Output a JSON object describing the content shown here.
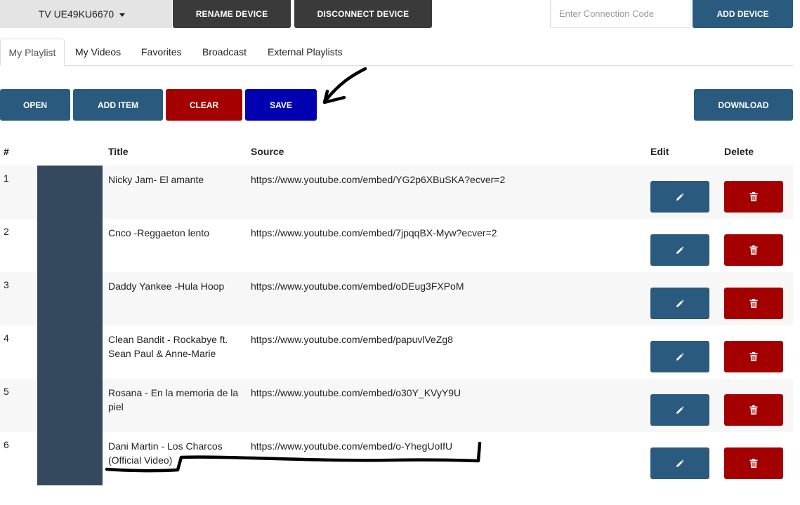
{
  "topbar": {
    "device_name": "TV UE49KU6670",
    "rename_label": "RENAME DEVICE",
    "disconnect_label": "DISCONNECT DEVICE",
    "connection_placeholder": "Enter Connection Code",
    "add_device_label": "ADD DEVICE"
  },
  "tabs": [
    "My Playlist",
    "My Videos",
    "Favorites",
    "Broadcast",
    "External Playlists"
  ],
  "toolbar": {
    "open": "OPEN",
    "add_item": "ADD ITEM",
    "clear": "CLEAR",
    "save": "SAVE",
    "download": "DOWNLOAD"
  },
  "table": {
    "headers": {
      "num": "#",
      "title": "Title",
      "source": "Source",
      "edit": "Edit",
      "delete": "Delete"
    },
    "rows": [
      {
        "num": "1",
        "title": "Nicky Jam- El amante",
        "source": "https://www.youtube.com/embed/YG2p6XBuSKA?ecver=2"
      },
      {
        "num": "2",
        "title": "Cnco -Reggaeton lento",
        "source": "https://www.youtube.com/embed/7jpqqBX-Myw?ecver=2"
      },
      {
        "num": "3",
        "title": "Daddy Yankee -Hula Hoop",
        "source": "https://www.youtube.com/embed/oDEug3FXPoM"
      },
      {
        "num": "4",
        "title": "Clean Bandit - Rockabye ft. Sean Paul & Anne-Marie",
        "source": "https://www.youtube.com/embed/papuvlVeZg8"
      },
      {
        "num": "5",
        "title": "Rosana - En la memoria de la piel",
        "source": "https://www.youtube.com/embed/o30Y_KVyY9U"
      },
      {
        "num": "6",
        "title": "Dani Martin - Los Charcos (Official Video)",
        "source": "https://www.youtube.com/embed/o-YhegUoIfU"
      }
    ]
  },
  "icons": {
    "edit": "pencil-icon",
    "delete": "trash-icon",
    "dropdown": "caret-down-icon"
  },
  "colors": {
    "primary": "#2a5b7e",
    "danger": "#a50000",
    "save": "#0000b0",
    "dark": "#3a3a3a",
    "thumb": "#34495e"
  }
}
